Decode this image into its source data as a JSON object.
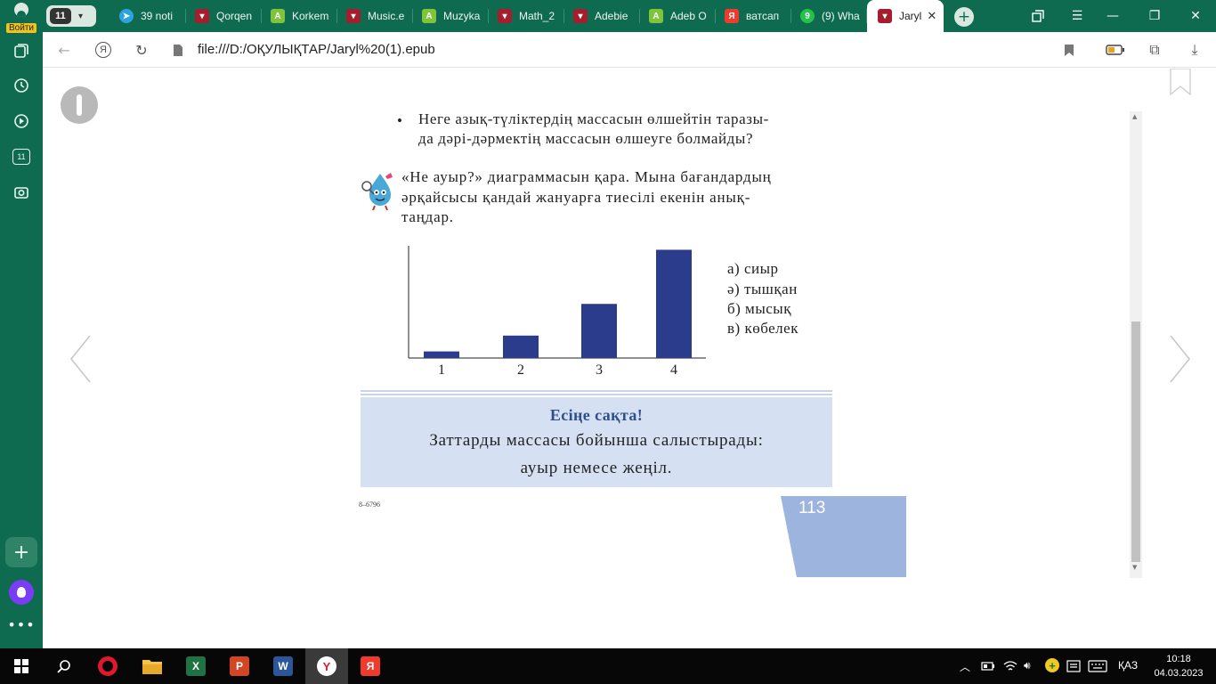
{
  "sidebar": {
    "login_label": "Войти",
    "group_badge": "11"
  },
  "tabs": {
    "group_count": "11",
    "items": [
      {
        "label": "39 noti",
        "icon": "telegram-icon",
        "color": "#2aa3e0",
        "glyph": "➤"
      },
      {
        "label": "Qorqen",
        "icon": "book-icon",
        "color": "#a51e2e",
        "glyph": "▾"
      },
      {
        "label": "Korkem",
        "icon": "a-letter-icon",
        "color": "#7fc53a",
        "glyph": "A"
      },
      {
        "label": "Music.e",
        "icon": "book-icon",
        "color": "#a51e2e",
        "glyph": "▾"
      },
      {
        "label": "Muzyka",
        "icon": "a-letter-icon",
        "color": "#7fc53a",
        "glyph": "A"
      },
      {
        "label": "Math_2",
        "icon": "book-icon",
        "color": "#a51e2e",
        "glyph": "▾"
      },
      {
        "label": "Adebie",
        "icon": "book-icon",
        "color": "#a51e2e",
        "glyph": "▾"
      },
      {
        "label": "Adeb O",
        "icon": "a-letter-icon",
        "color": "#7fc53a",
        "glyph": "A"
      },
      {
        "label": "ватсап",
        "icon": "yandex-icon",
        "color": "#f03a2e",
        "glyph": "Я"
      },
      {
        "label": "(9) Wha",
        "icon": "whatsapp-icon",
        "color": "#25c24a",
        "glyph": "9"
      }
    ],
    "active_label": "Jaryl"
  },
  "address": {
    "url": "file:///D:/ОҚУЛЫҚТАР/Jaryl%20(1).epub"
  },
  "page": {
    "question_bullet": "•",
    "question_lines": [
      "Неге азық-түліктердің массасын өлшейтін таразы-",
      "да дәрі-дәрмектің массасын өлшеуге болмайды?"
    ],
    "task_lines": [
      "«Не ауыр?» диаграммасын қара. Мына бағандардың",
      "әрқайсысы қандай жануарға тиесілі екенін анық-",
      "таңдар."
    ],
    "options": [
      "а) сиыр",
      "ә) тышқан",
      "б) мысық",
      "в) көбелек"
    ],
    "remember_title": "Есіңе сақта!",
    "remember_lines": [
      "Заттарды массасы бойынша салыстырады:",
      "ауыр немесе жеңіл."
    ],
    "code": "8–6796",
    "page_number": "113"
  },
  "chart_data": {
    "type": "bar",
    "categories": [
      "1",
      "2",
      "3",
      "4"
    ],
    "values": [
      0.5,
      1.7,
      4.1,
      8.2
    ],
    "ylim": [
      0,
      8.5
    ],
    "color": "#2c3c8c",
    "title": "",
    "xlabel": "",
    "ylabel": ""
  },
  "taskbar": {
    "language": "ҚАЗ",
    "time": "10:18",
    "date": "04.03.2023"
  }
}
